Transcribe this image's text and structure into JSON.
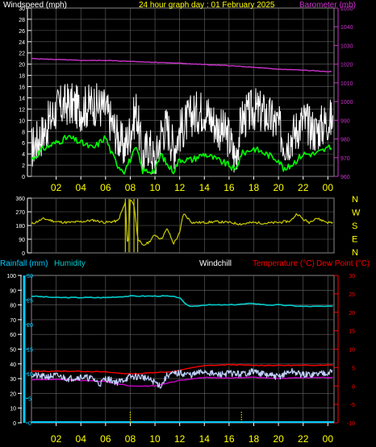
{
  "colors": {
    "windspeed": "#ffffff",
    "windgust_avg": "#00ff00",
    "barometer": "#cc33cc",
    "title": "#ffff00",
    "grid": "#666666",
    "wind_direction": "#cccc00",
    "rainfall": "#00ccff",
    "humidity": "#00cccc",
    "windchill": "#c0d0ff",
    "temperature": "#ff0000",
    "dewpoint": "#cc00cc",
    "rain_events": "#cccc00"
  },
  "chart_data": [
    {
      "type": "line",
      "title": "24 hour graph day : 01 February 2025",
      "left_axis_label": "Windspeed (mph)",
      "right_axis_label": "Barometer (mb)",
      "left_ticks": [
        "0",
        "2",
        "4",
        "6",
        "8",
        "10",
        "12",
        "14",
        "16",
        "18",
        "20",
        "22",
        "24",
        "26",
        "28",
        "30"
      ],
      "right_ticks": [
        "960",
        "970",
        "980",
        "990",
        "1000",
        "1010",
        "1020",
        "1030",
        "1040",
        "1050"
      ],
      "x_ticks": [
        "02",
        "04",
        "06",
        "08",
        "10",
        "12",
        "14",
        "16",
        "18",
        "20",
        "22",
        "00"
      ],
      "ylim_left": [
        0,
        30
      ],
      "ylim_right": [
        960,
        1050
      ],
      "grid": true,
      "series": [
        {
          "name": "Windspeed",
          "axis": "left",
          "hours": [
            0,
            1,
            2,
            3,
            4,
            5,
            6,
            7,
            7.5,
            8,
            8.5,
            9,
            9.5,
            10,
            10.5,
            11,
            11.5,
            12,
            13,
            14,
            15,
            16,
            16.5,
            17,
            18,
            19,
            20,
            20.5,
            21,
            22,
            23,
            24
          ],
          "values": [
            5,
            8,
            12,
            13,
            12,
            13,
            12,
            7,
            5,
            8,
            12,
            3,
            6,
            2,
            8,
            9,
            5,
            8,
            11,
            12,
            9,
            7,
            3,
            10,
            12,
            11,
            9,
            6,
            7,
            10,
            8,
            10
          ]
        },
        {
          "name": "Gust average",
          "axis": "left",
          "hours": [
            0,
            1,
            2,
            3,
            4,
            5,
            6,
            6.5,
            7,
            7.5,
            8,
            8.5,
            9,
            10,
            10.5,
            11,
            11.5,
            12,
            13,
            14,
            15,
            16,
            16.5,
            17,
            18,
            19,
            20,
            20.5,
            21,
            22,
            23,
            24
          ],
          "values": [
            3,
            5,
            6,
            7,
            6,
            5,
            7,
            4,
            2,
            1,
            3,
            5,
            1,
            1,
            4,
            2,
            1,
            3,
            3,
            4,
            3,
            2,
            1,
            4,
            5,
            4,
            3,
            1,
            2,
            4,
            4,
            5
          ]
        },
        {
          "name": "Barometer",
          "axis": "right",
          "hours": [
            0,
            2,
            4,
            6,
            8,
            10,
            12,
            14,
            16,
            18,
            20,
            22,
            24
          ],
          "values": [
            1023,
            1022.5,
            1022,
            1022,
            1021.5,
            1021,
            1020.5,
            1019.8,
            1019.2,
            1018.3,
            1017.3,
            1016.8,
            1016
          ]
        }
      ]
    },
    {
      "type": "line",
      "right_labels": [
        "N",
        "W",
        "S",
        "E",
        "N"
      ],
      "left_ticks": [
        "360",
        "270",
        "180",
        "90",
        "0"
      ],
      "ylim": [
        0,
        360
      ],
      "series": [
        {
          "name": "Wind direction",
          "hours": [
            0,
            1,
            2,
            3,
            4,
            5,
            6,
            7,
            7.6,
            7.8,
            8,
            8.3,
            8.6,
            9,
            9.5,
            10,
            10.5,
            11,
            11.5,
            12,
            12.3,
            13,
            14,
            15,
            16,
            17,
            18,
            19,
            20,
            21,
            21.5,
            22,
            22.5,
            23,
            24
          ],
          "values": [
            190,
            225,
            205,
            200,
            205,
            215,
            200,
            210,
            330,
            10,
            350,
            320,
            100,
            45,
            70,
            120,
            90,
            160,
            60,
            130,
            260,
            200,
            200,
            205,
            200,
            190,
            200,
            195,
            200,
            210,
            260,
            220,
            200,
            230,
            200
          ]
        }
      ]
    },
    {
      "type": "line",
      "left_axis_label": "Rainfall (mm)",
      "humidity_label": "Humidity",
      "windchill_label": "Windchill",
      "temperature_label": "Temperature (°C)",
      "dewpoint_label": "Dew Point (°C)",
      "rain_ticks": [
        "0",
        "5",
        "10",
        "15",
        "20",
        "25",
        "30"
      ],
      "humidity_ticks": [
        "0",
        "10",
        "20",
        "30",
        "40",
        "50",
        "60",
        "70",
        "80",
        "90",
        "100"
      ],
      "right_ticks": [
        "-10",
        "-5",
        "0",
        "5",
        "10",
        "15",
        "20",
        "25",
        "30"
      ],
      "x_ticks": [
        "02",
        "04",
        "06",
        "08",
        "10",
        "12",
        "14",
        "16",
        "18",
        "20",
        "22",
        "00"
      ],
      "ylim_left": [
        0,
        100
      ],
      "ylim_right": [
        -10,
        30
      ],
      "grid": true,
      "series": [
        {
          "name": "Humidity",
          "axis": "left",
          "hours": [
            0,
            2,
            4,
            6,
            8,
            10,
            11,
            12,
            12.5,
            13,
            14,
            16,
            18,
            19,
            20,
            22,
            24
          ],
          "values": [
            86,
            85,
            85,
            85,
            86,
            86,
            86,
            85,
            80,
            79,
            80,
            80,
            81,
            80,
            80,
            79,
            79
          ]
        },
        {
          "name": "Temperature",
          "axis": "right",
          "hours": [
            0,
            2,
            4,
            6,
            7,
            8,
            9,
            10,
            11,
            12,
            13,
            14,
            16,
            18,
            20,
            22,
            24
          ],
          "values": [
            4,
            4,
            4,
            3.8,
            3.5,
            3.3,
            3.4,
            3.7,
            3.8,
            4.2,
            5,
            5.5,
            5.8,
            5.6,
            5.6,
            5.6,
            5.7
          ]
        },
        {
          "name": "Windchill",
          "axis": "right",
          "hours": [
            0,
            1,
            2,
            3,
            4,
            5,
            5.5,
            6,
            7,
            8,
            9,
            10,
            10.5,
            11,
            12,
            13,
            14,
            15,
            16,
            17,
            18,
            19,
            20,
            21,
            22,
            23,
            24
          ],
          "values": [
            3,
            2.5,
            2.8,
            2,
            2.5,
            2,
            0.5,
            2,
            1,
            2.5,
            2.5,
            1,
            0,
            3,
            3.5,
            3,
            4,
            3,
            3.5,
            3.2,
            4,
            3,
            2.5,
            4,
            3,
            3.2,
            3.8
          ]
        },
        {
          "name": "Dew Point",
          "axis": "right",
          "hours": [
            0,
            2,
            4,
            6,
            8,
            9,
            10,
            11,
            12,
            13,
            14,
            16,
            18,
            20,
            22,
            24
          ],
          "values": [
            1.7,
            1.8,
            1.5,
            1.2,
            0,
            0,
            0,
            0.8,
            1.5,
            2,
            2.3,
            2.2,
            2.4,
            2,
            2.3,
            2.3
          ]
        }
      ],
      "rain_events_hours": [
        8,
        17
      ]
    }
  ]
}
